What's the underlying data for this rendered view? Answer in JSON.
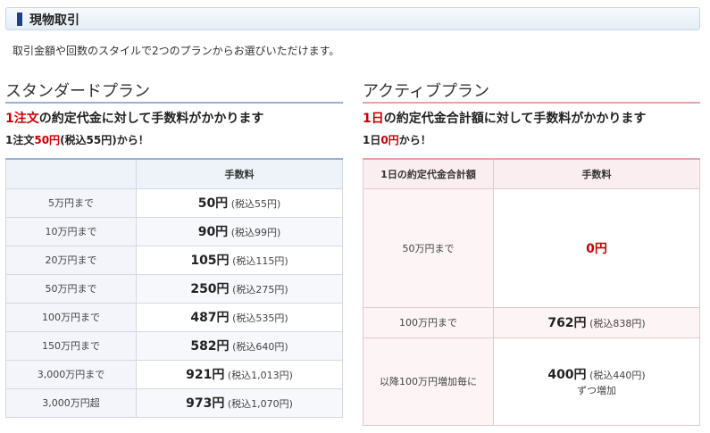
{
  "header": {
    "title": "現物取引"
  },
  "intro": "取引金額や回数のスタイルで2つのプランからお選びいただけます。",
  "standard": {
    "title": "スタンダードプラン",
    "desc_red": "1注文",
    "desc_rest": "の約定代金に対して手数料がかかります",
    "sub_pre": "1注文",
    "sub_red": "50円",
    "sub_post": "(税込55円)から！",
    "col_fee": "手数料",
    "rows": [
      {
        "label": "5万円まで",
        "fee": "50円",
        "tax": "(税込55円)"
      },
      {
        "label": "10万円まで",
        "fee": "90円",
        "tax": "(税込99円)"
      },
      {
        "label": "20万円まで",
        "fee": "105円",
        "tax": "(税込115円)"
      },
      {
        "label": "50万円まで",
        "fee": "250円",
        "tax": "(税込275円)"
      },
      {
        "label": "100万円まで",
        "fee": "487円",
        "tax": "(税込535円)"
      },
      {
        "label": "150万円まで",
        "fee": "582円",
        "tax": "(税込640円)"
      },
      {
        "label": "3,000万円まで",
        "fee": "921円",
        "tax": "(税込1,013円)"
      },
      {
        "label": "3,000万円超",
        "fee": "973円",
        "tax": "(税込1,070円)"
      }
    ]
  },
  "active": {
    "title": "アクティブプラン",
    "desc_red": "1日",
    "desc_rest": "の約定代金合計額に対して手数料がかかります",
    "sub_pre": "1日",
    "sub_red": "0円",
    "sub_post": "から！",
    "col_amount": "1日の約定代金合計額",
    "col_fee": "手数料",
    "row1": {
      "label": "50万円まで",
      "fee": "0円"
    },
    "row2": {
      "label": "100万円まで",
      "fee": "762円",
      "tax": "(税込838円)"
    },
    "row3": {
      "label": "以降100万円増加毎に",
      "fee": "400円",
      "tax": "(税込440円)",
      "note": "ずつ増加"
    }
  },
  "colors": {
    "accent_blue": "#1b3f8f",
    "accent_red": "#cc0000"
  }
}
